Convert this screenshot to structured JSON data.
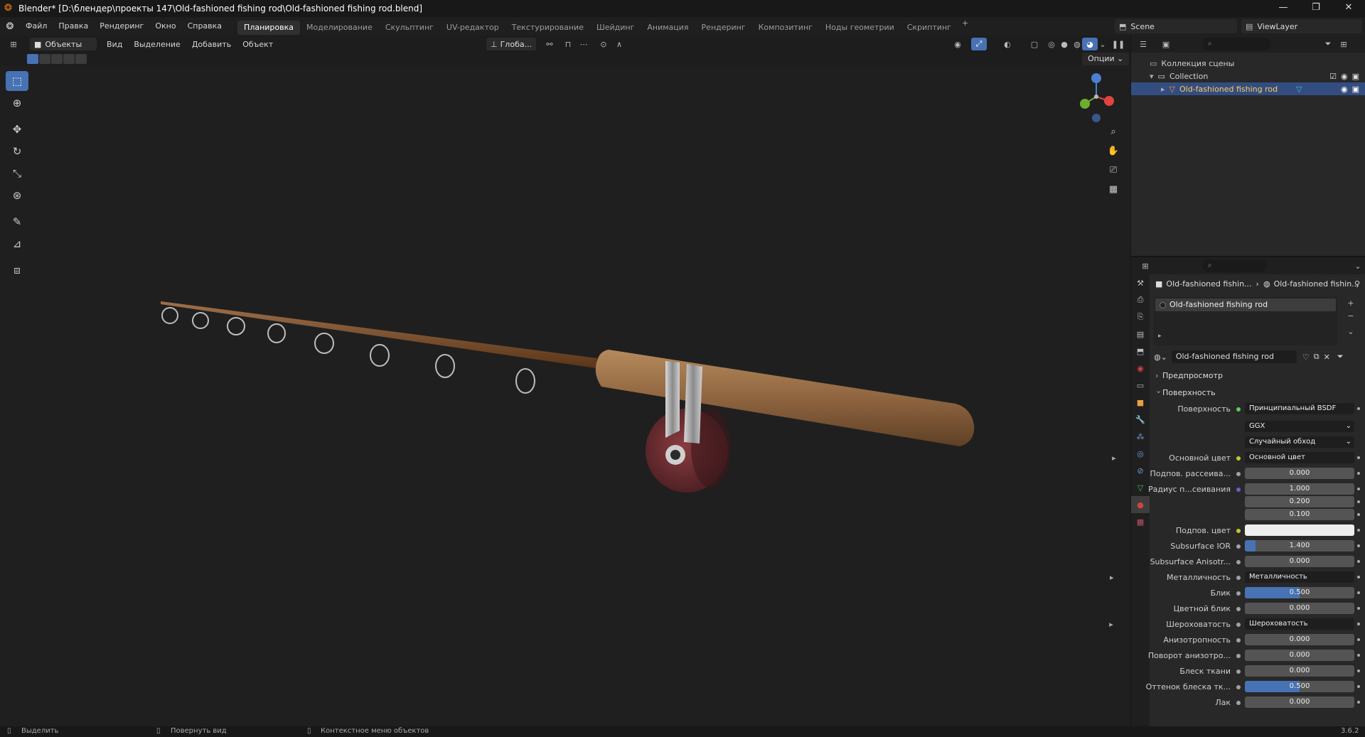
{
  "window": {
    "title": "Blender* [D:\\блендер\\проекты 147\\Old-fashioned fishing rod\\Old-fashioned fishing rod.blend]",
    "controls": [
      "—",
      "❐",
      "✕"
    ]
  },
  "menubar": {
    "items": [
      "Файл",
      "Правка",
      "Рендеринг",
      "Окно",
      "Справка"
    ],
    "workspaces": [
      "Планировка",
      "Моделирование",
      "Скульптинг",
      "UV-редактор",
      "Текстурирование",
      "Шейдинг",
      "Анимация",
      "Рендеринг",
      "Композитинг",
      "Ноды геометрии",
      "Скриптинг"
    ],
    "active_workspace": "Планировка",
    "plus": "+",
    "scene": "Scene",
    "view_layer": "ViewLayer"
  },
  "viewport_header": {
    "mode": "Объекты",
    "menus": [
      "Вид",
      "Выделение",
      "Добавить",
      "Объект"
    ],
    "transform_orientation": "Глоба...",
    "options": "Опции"
  },
  "outliner": {
    "root": "Коллекция сцены",
    "collection": "Collection",
    "object": "Old-fashioned fishing rod"
  },
  "properties": {
    "breadcrumb_object": "Old-fashioned fishin...",
    "breadcrumb_material": "Old-fashioned fishin...",
    "slot": "Old-fashioned fishing rod",
    "material_name": "Old-fashioned fishing rod",
    "panels": {
      "preview": "Предпросмотр",
      "surface": "Поверхность"
    },
    "rows": [
      {
        "label": "Поверхность",
        "value": "Принципиальный BSDF",
        "kind": "link",
        "dot": "#63c763"
      },
      {
        "label": "",
        "value": "GGX",
        "kind": "dropdown"
      },
      {
        "label": "",
        "value": "Случайный обход",
        "kind": "dropdown"
      },
      {
        "label": "Основной цвет",
        "value": "Основной цвет",
        "kind": "link",
        "dot": "#c7c729",
        "expand": true
      },
      {
        "label": "Подпов. рассеива...",
        "value": "0.000",
        "kind": "num",
        "dot": "#a1a1a1"
      },
      {
        "label": "Радиус п...сеивания",
        "value": "1.000",
        "kind": "num",
        "dot": "#6363c7"
      },
      {
        "label": "",
        "value": "0.200",
        "kind": "num"
      },
      {
        "label": "",
        "value": "0.100",
        "kind": "num"
      },
      {
        "label": "Подпов. цвет",
        "value": "",
        "kind": "color",
        "dot": "#c7c729"
      },
      {
        "label": "Subsurface IOR",
        "value": "1.400",
        "kind": "num",
        "dot": "#a1a1a1",
        "fill": 0.1
      },
      {
        "label": "Subsurface Anisotr...",
        "value": "0.000",
        "kind": "num",
        "dot": "#a1a1a1"
      },
      {
        "label": "Металличность",
        "value": "Металличность",
        "kind": "link",
        "dot": "#a1a1a1",
        "expand": true
      },
      {
        "label": "Блик",
        "value": "0.500",
        "kind": "num",
        "dot": "#a1a1a1",
        "fill": 0.5
      },
      {
        "label": "Цветной блик",
        "value": "0.000",
        "kind": "num",
        "dot": "#a1a1a1"
      },
      {
        "label": "Шероховатость",
        "value": "Шероховатость",
        "kind": "link",
        "dot": "#a1a1a1",
        "expand": true
      },
      {
        "label": "Анизотропность",
        "value": "0.000",
        "kind": "num",
        "dot": "#a1a1a1"
      },
      {
        "label": "Поворот анизотро...",
        "value": "0.000",
        "kind": "num",
        "dot": "#a1a1a1"
      },
      {
        "label": "Блеск ткани",
        "value": "0.000",
        "kind": "num",
        "dot": "#a1a1a1"
      },
      {
        "label": "Оттенок блеска тк...",
        "value": "0.500",
        "kind": "num",
        "dot": "#a1a1a1",
        "fill": 0.5
      },
      {
        "label": "Лак",
        "value": "0.000",
        "kind": "num",
        "dot": "#a1a1a1"
      }
    ]
  },
  "statusbar": {
    "select": "Выделить",
    "rotate": "Повернуть вид",
    "context": "Контекстное меню объектов",
    "version": "3.6.2"
  },
  "colors": {
    "accent": "#4772b3",
    "selected_row": "#334d80",
    "object_name": "#ffcd56"
  }
}
